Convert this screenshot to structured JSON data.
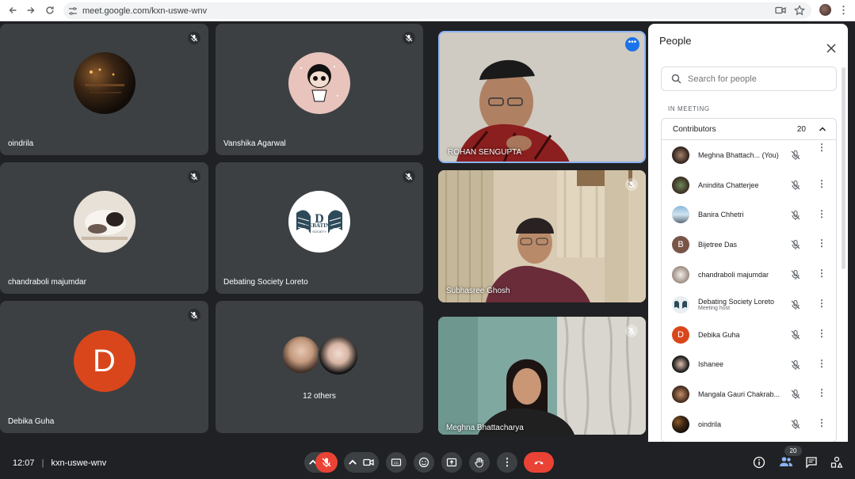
{
  "browser": {
    "url": "meet.google.com/kxn-uswe-wnv"
  },
  "tiles": [
    {
      "name": "oindrila"
    },
    {
      "name": "Vanshika Agarwal"
    },
    {
      "name": "ROHAN SENGUPTA"
    },
    {
      "name": "chandraboli majumdar"
    },
    {
      "name": "Debating Society Loreto"
    },
    {
      "name": "Subhasree Ghosh"
    },
    {
      "name": "Debika Guha",
      "initial": "D"
    },
    {
      "name": "12 others"
    },
    {
      "name": "Meghna Bhattacharya"
    }
  ],
  "debating_logo": {
    "line1": "DEBATING",
    "line2": "SOCIETY"
  },
  "panel": {
    "title": "People",
    "search_placeholder": "Search for people",
    "section_label": "IN MEETING",
    "group_label": "Contributors",
    "group_count": "20",
    "people": [
      {
        "name": "Meghna Bhattach...",
        "tag": "(You)",
        "sub": ""
      },
      {
        "name": "Anindita Chatterjee",
        "sub": ""
      },
      {
        "name": "Banira Chhetri",
        "sub": ""
      },
      {
        "name": "Bijetree Das",
        "initial": "B",
        "sub": ""
      },
      {
        "name": "chandraboli majumdar",
        "sub": ""
      },
      {
        "name": "Debating Society Loreto",
        "sub": "Meeting host"
      },
      {
        "name": "Debika Guha",
        "initial": "D",
        "sub": ""
      },
      {
        "name": "Ishanee",
        "sub": ""
      },
      {
        "name": "Mangala Gauri Chakrab...",
        "sub": ""
      },
      {
        "name": "oindrila",
        "sub": ""
      }
    ]
  },
  "bottom": {
    "time": "12:07",
    "separator": "|",
    "meeting_code": "kxn-uswe-wnv",
    "people_badge": "20"
  },
  "colors": {
    "accent_blue": "#1a73e8",
    "end_call_red": "#ea4335",
    "tile_bg": "#3c4043",
    "stage_bg": "#202124"
  }
}
